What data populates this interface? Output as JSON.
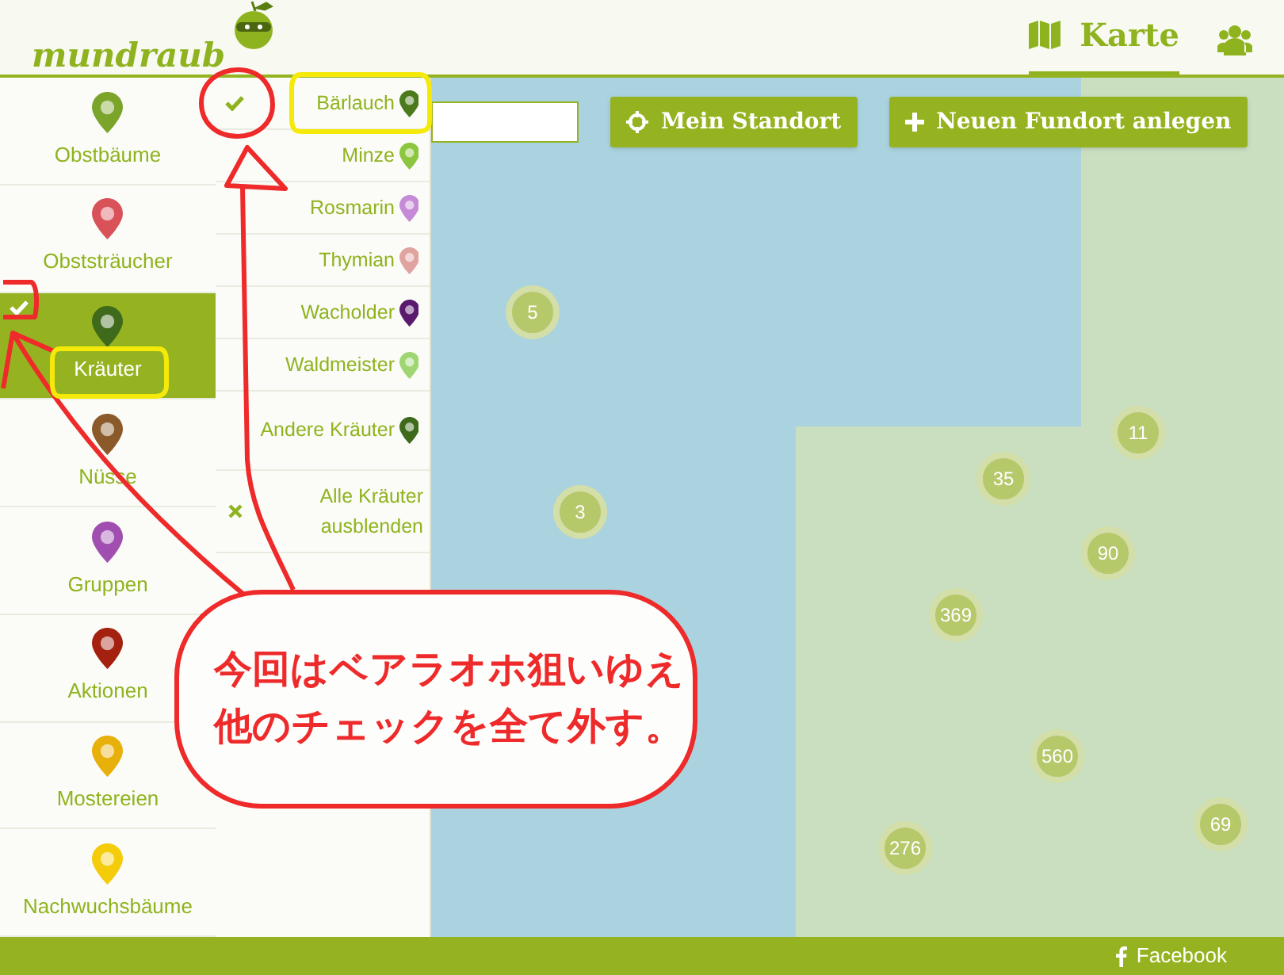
{
  "header": {
    "logo": "mundraub",
    "nav": [
      {
        "label": "Karte",
        "selected": true
      }
    ]
  },
  "categories": [
    {
      "label": "Obstbäume",
      "selected": false,
      "checked": false,
      "color": "#7aa42a"
    },
    {
      "label": "Obststräucher",
      "selected": false,
      "checked": false,
      "color": "#d9525a"
    },
    {
      "label": "Kräuter",
      "selected": true,
      "checked": true,
      "color": "#3f6a1c"
    },
    {
      "label": "Nüsse",
      "selected": false,
      "checked": false,
      "color": "#8a5a2b"
    },
    {
      "label": "Gruppen",
      "selected": false,
      "checked": false,
      "color": "#a04fb0"
    },
    {
      "label": "Aktionen",
      "selected": false,
      "checked": false,
      "color": "#a4200f"
    },
    {
      "label": "Mostereien",
      "selected": false,
      "checked": false,
      "color": "#e8b00a"
    },
    {
      "label": "Nachwuchsbäume",
      "selected": false,
      "checked": false,
      "color": "#f5cc0a"
    }
  ],
  "herbs": [
    {
      "kind": "item",
      "label": "Bärlauch",
      "checked": true,
      "color": "#4a7a1c"
    },
    {
      "kind": "item",
      "label": "Minze",
      "checked": false,
      "color": "#8cc63f"
    },
    {
      "kind": "item",
      "label": "Rosmarin",
      "checked": false,
      "color": "#c58bd6"
    },
    {
      "kind": "item",
      "label": "Thymian",
      "checked": false,
      "color": "#e0a3a0"
    },
    {
      "kind": "item",
      "label": "Wacholder",
      "checked": false,
      "color": "#5a1a6e"
    },
    {
      "kind": "item",
      "label": "Waldmeister",
      "checked": false,
      "color": "#9fd673"
    },
    {
      "kind": "item",
      "label": "Andere Kräuter",
      "checked": false,
      "color": "#3f6a1c"
    },
    {
      "kind": "hide-all",
      "label": "Alle Kräuter ausblenden"
    }
  ],
  "map_controls": {
    "buttons": [
      {
        "label": "Mein Standort"
      },
      {
        "label": "Neuen Fundort anlegen"
      }
    ]
  },
  "clusters": [
    "5",
    "11",
    "35",
    "3",
    "90",
    "369",
    "560",
    "276",
    "69"
  ],
  "annotation": {
    "lines": [
      "今回はベアラオホ狙いゆえ",
      "他のチェックを全て外す。"
    ]
  },
  "footer": {
    "links": [
      "Facebook"
    ]
  }
}
